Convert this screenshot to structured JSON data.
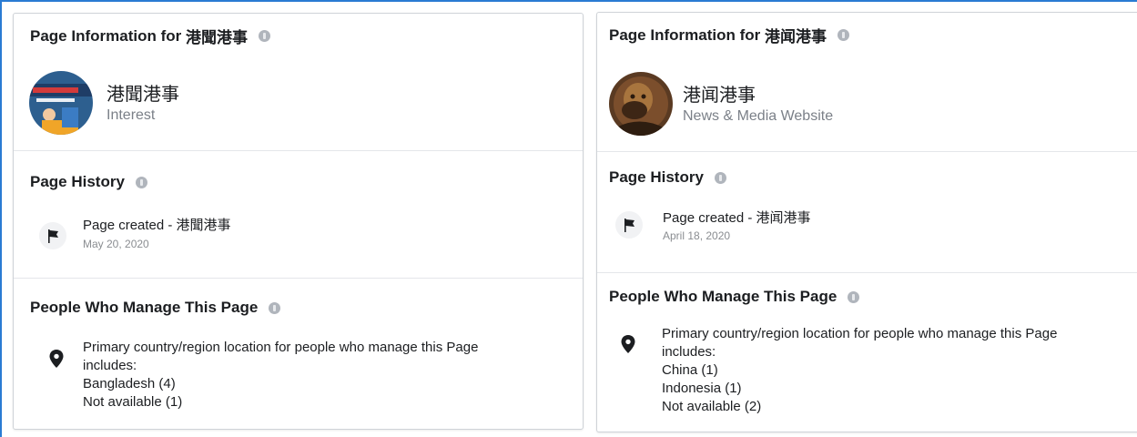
{
  "left": {
    "page_info_prefix": "Page Information for",
    "page_info_name": "港聞港事",
    "page_name": "港聞港事",
    "page_category": "Interest",
    "history_heading": "Page History",
    "history_entry": "Page created - 港聞港事",
    "history_date": "May 20, 2020",
    "managers_heading": "People Who Manage This Page",
    "managers_intro_1": "Primary country/region location for people who manage this Page",
    "managers_intro_2": "includes:",
    "locations": [
      "Bangladesh (4)",
      "Not available (1)"
    ]
  },
  "right": {
    "page_info_prefix": "Page Information for",
    "page_info_name": "港闻港事",
    "page_name": "港闻港事",
    "page_category": "News & Media Website",
    "history_heading": "Page History",
    "history_entry": "Page created - 港闻港事",
    "history_date": "April 18, 2020",
    "managers_heading": "People Who Manage This Page",
    "managers_intro_1": "Primary country/region location for people who manage this Page",
    "managers_intro_2": "includes:",
    "locations": [
      "China (1)",
      "Indonesia (1)",
      "Not available (2)"
    ]
  },
  "icons": {
    "info": "info-icon",
    "history": "flag-icon",
    "location": "location-pin-icon"
  },
  "colors": {
    "frame_border": "#2a7bd3",
    "muted_text": "#7b8088",
    "info_icon": "#b0b5bc"
  }
}
